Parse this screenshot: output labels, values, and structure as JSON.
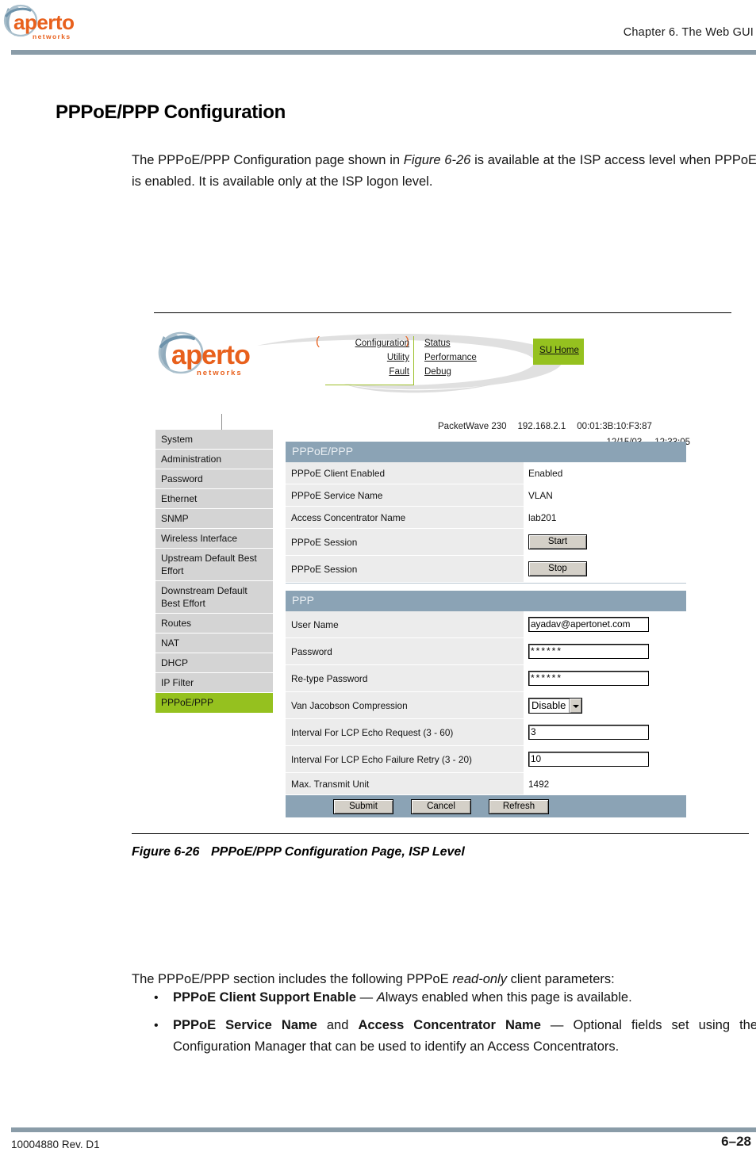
{
  "page": {
    "chapter_header": "Chapter 6.  The Web GUI",
    "section_heading": "PPPoE/PPP Configuration",
    "intro_paragraph_part1": "The PPPoE/PPP Configuration page shown in ",
    "intro_paragraph_figref": "Figure 6-26",
    "intro_paragraph_part2": " is available at the ISP access level when PPPoE is enabled. It is available only at the ISP logon level.",
    "footer_left": "10004880 Rev. D1",
    "footer_right": "6–28",
    "rule_color": "#8a9ca8"
  },
  "logo": {
    "wordmark": "aperto",
    "tagline": "n e t w o r k s",
    "wordmark_color": "#e8601c",
    "swoosh_color": "#7d9cb0"
  },
  "figure": {
    "caption_number": "Figure 6-26",
    "caption_text": "PPPoE/PPP Configuration Page, ISP Level"
  },
  "gui": {
    "nav": {
      "left_column": [
        "Configuration",
        "Utility",
        "Fault"
      ],
      "right_column": [
        "Status",
        "Performance",
        "Debug"
      ],
      "paren_left": "(",
      "paren_right": ")",
      "paren_color": "#e8601c",
      "underline_color": "#9dbf2a",
      "su_home_label": "SU Home",
      "su_home_bg": "#95c11f"
    },
    "device_info": {
      "model": "PacketWave 230",
      "ip": "192.168.2.1",
      "mac": "00:01:3B:10:F3:87",
      "date": "12/15/03",
      "time": "12:33:05"
    },
    "sidebar": {
      "items": [
        {
          "label": "System",
          "active": false,
          "two_line": false
        },
        {
          "label": "Administration",
          "active": false,
          "two_line": false
        },
        {
          "label": "Password",
          "active": false,
          "two_line": false
        },
        {
          "label": "Ethernet",
          "active": false,
          "two_line": false
        },
        {
          "label": "SNMP",
          "active": false,
          "two_line": false
        },
        {
          "label": "Wireless Interface",
          "active": false,
          "two_line": false
        },
        {
          "label": "Upstream Default Best Effort",
          "active": false,
          "two_line": true
        },
        {
          "label": "Downstream Default Best Effort",
          "active": false,
          "two_line": true
        },
        {
          "label": "Routes",
          "active": false,
          "two_line": false
        },
        {
          "label": "NAT",
          "active": false,
          "two_line": false
        },
        {
          "label": "DHCP",
          "active": false,
          "two_line": false
        },
        {
          "label": "IP Filter",
          "active": false,
          "two_line": false
        },
        {
          "label": "PPPoE/PPP",
          "active": true,
          "two_line": false
        }
      ],
      "active_bg": "#95c11f",
      "item_bg": "#d4d4d4"
    },
    "panel_header_bg": "#8ba3b5",
    "pppoe_panel": {
      "title": "PPPoE/PPP",
      "rows": [
        {
          "label": "PPPoE Client Enabled",
          "value": "Enabled",
          "type": "text"
        },
        {
          "label": "PPPoE Service Name",
          "value": "VLAN",
          "type": "text"
        },
        {
          "label": "Access Concentrator Name",
          "value": "lab201",
          "type": "text"
        },
        {
          "label": "PPPoE Session",
          "value": "Start",
          "type": "button"
        },
        {
          "label": "PPPoE Session",
          "value": "Stop",
          "type": "button"
        }
      ]
    },
    "ppp_panel": {
      "title": "PPP",
      "rows": [
        {
          "label": "User Name",
          "value": "ayadav@apertonet.com",
          "type": "input"
        },
        {
          "label": "Password",
          "value": "******",
          "type": "input"
        },
        {
          "label": "Re-type Password",
          "value": "******",
          "type": "input"
        },
        {
          "label": "Van Jacobson Compression",
          "value": "Disable",
          "type": "select"
        },
        {
          "label": "Interval For LCP Echo Request (3 - 60)",
          "value": "3",
          "type": "input"
        },
        {
          "label": "Interval For LCP Echo Failure Retry (3 - 20)",
          "value": "10",
          "type": "input"
        },
        {
          "label": "Max. Transmit Unit",
          "value": "1492",
          "type": "text"
        }
      ],
      "actions": [
        "Submit",
        "Cancel",
        "Refresh"
      ]
    }
  },
  "body": {
    "lead_in_part1": "The PPPoE/PPP section includes the following PPPoE ",
    "lead_in_italic": "read-only",
    "lead_in_part2": " client parameters:",
    "bullets": [
      {
        "bold": "PPPoE  Client Support Enable",
        "dash": " — ",
        "italic_start": "A",
        "rest": "lways enabled when this page is available."
      },
      {
        "bold": "PPPoE Service Name",
        "mid": " and ",
        "bold2": "Access Concentrator Name",
        "dash": " — ",
        "rest": "Optional fields set using the Configuration Manager that can be used to identify an Access Concentrators."
      }
    ]
  }
}
